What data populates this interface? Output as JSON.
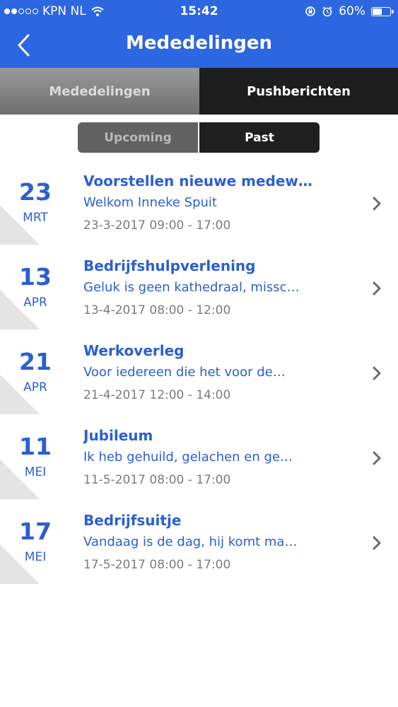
{
  "status_bar": {
    "carrier": "KPN NL",
    "time": "15:42",
    "battery": "60%",
    "battery_level": 0.6,
    "icons": [
      "signal-dots-icon",
      "wifi-icon",
      "orientation-lock-icon",
      "alarm-icon",
      "battery-icon"
    ]
  },
  "navbar": {
    "title": "Mededelingen",
    "back_icon": "chevron-left-icon"
  },
  "tabs": [
    {
      "label": "Mededelingen",
      "active": false
    },
    {
      "label": "Pushberichten",
      "active": true
    }
  ],
  "segment": [
    {
      "label": "Upcoming",
      "active": false
    },
    {
      "label": "Past",
      "active": true
    }
  ],
  "items": [
    {
      "day": "23",
      "month": "MRT",
      "title": "Voorstellen nieuwe medew…",
      "subtitle": "Welkom Inneke Spuit",
      "datetime": "23-3-2017 09:00 - 17:00"
    },
    {
      "day": "13",
      "month": "APR",
      "title": "Bedrijfshulpverlening",
      "subtitle": "Geluk is geen kathedraal, missc…",
      "datetime": "13-4-2017 08:00 - 12:00"
    },
    {
      "day": "21",
      "month": "APR",
      "title": "Werkoverleg",
      "subtitle": "Voor iedereen die het voor de…",
      "datetime": "21-4-2017 12:00 - 14:00"
    },
    {
      "day": "11",
      "month": "MEI",
      "title": "Jubileum",
      "subtitle": "Ik heb gehuild, gelachen en ge…",
      "datetime": "11-5-2017 08:00 - 17:00"
    },
    {
      "day": "17",
      "month": "MEI",
      "title": "Bedrijfsuitje",
      "subtitle": "Vandaag is de dag, hij komt ma…",
      "datetime": "17-5-2017 08:00 - 17:00"
    }
  ],
  "colors": {
    "primary": "#2c66e0",
    "text_blue": "#2b5fd1",
    "tab_active": "#1e1e1e",
    "meta_gray": "#7b7b7b"
  }
}
